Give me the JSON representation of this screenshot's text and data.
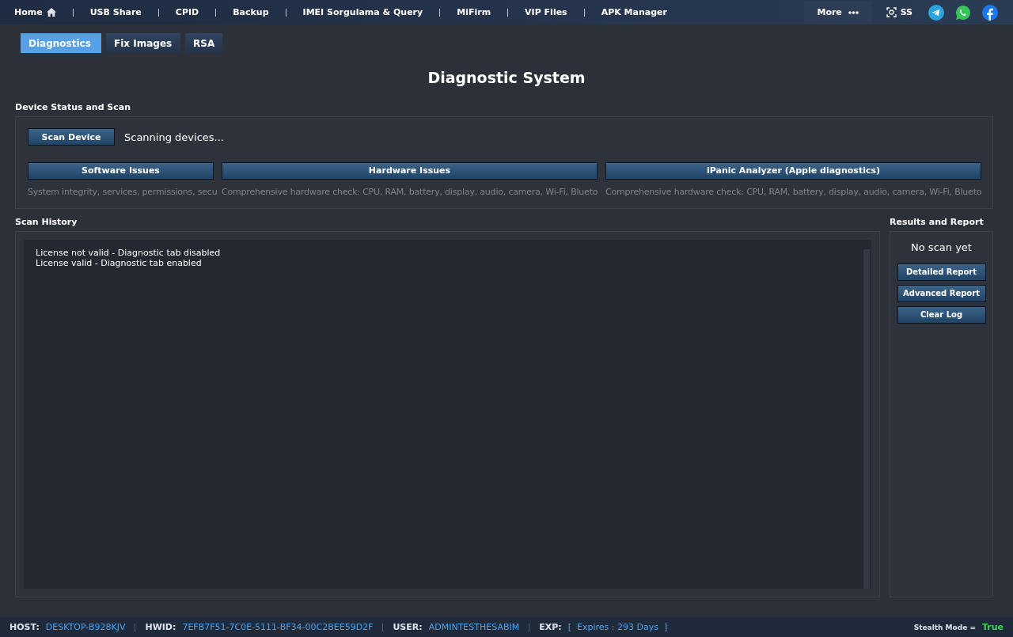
{
  "nav": {
    "items": [
      {
        "label": "Home"
      },
      {
        "label": "USB Share"
      },
      {
        "label": "CPID"
      },
      {
        "label": "Backup"
      },
      {
        "label": "IMEI Sorgulama & Query"
      },
      {
        "label": "MiFirm"
      },
      {
        "label": "VIP Files"
      },
      {
        "label": "APK Manager"
      }
    ],
    "more": "More",
    "screenshot": "SS"
  },
  "tabs": [
    {
      "label": "Diagnostics",
      "selected": true
    },
    {
      "label": "Fix Images",
      "selected": false
    },
    {
      "label": "RSA",
      "selected": false
    }
  ],
  "title": "Diagnostic System",
  "device_section": {
    "heading": "Device Status and Scan",
    "scan_button": "Scan Device",
    "status": "Scanning devices...",
    "checks": [
      {
        "button": "Software Issues",
        "description": "System integrity, services, permissions, secu"
      },
      {
        "button": "Hardware Issues",
        "description": "Comprehensive hardware check: CPU, RAM, battery, display, audio, camera, Wi-Fi, Blueto"
      },
      {
        "button": "iPanic Analyzer (Apple diagnostics)",
        "description": "Comprehensive hardware check: CPU, RAM, battery, display, audio, camera, Wi-Fi, Blueto"
      }
    ]
  },
  "history": {
    "heading": "Scan History",
    "lines": [
      "License not valid - Diagnostic tab disabled",
      "License valid - Diagnostic tab enabled"
    ]
  },
  "results": {
    "heading": "Results and Report",
    "status": "No scan yet",
    "buttons": [
      "Detailed Report",
      "Advanced Report",
      "Clear Log"
    ]
  },
  "status_bar": {
    "fields": [
      {
        "label": "HOST:",
        "value": "DESKTOP-B928KJV"
      },
      {
        "label": "HWID:",
        "value": "7EFB7F51-7C0E-5111-BF34-00C2BEE59D2F"
      },
      {
        "label": "USER:",
        "value": "ADMINTESTHESABIM"
      },
      {
        "label": "EXP:",
        "value": "[  Expires : 293 Days  ]"
      }
    ],
    "stealth_label": "Stealth Mode =",
    "stealth_value": "True"
  }
}
